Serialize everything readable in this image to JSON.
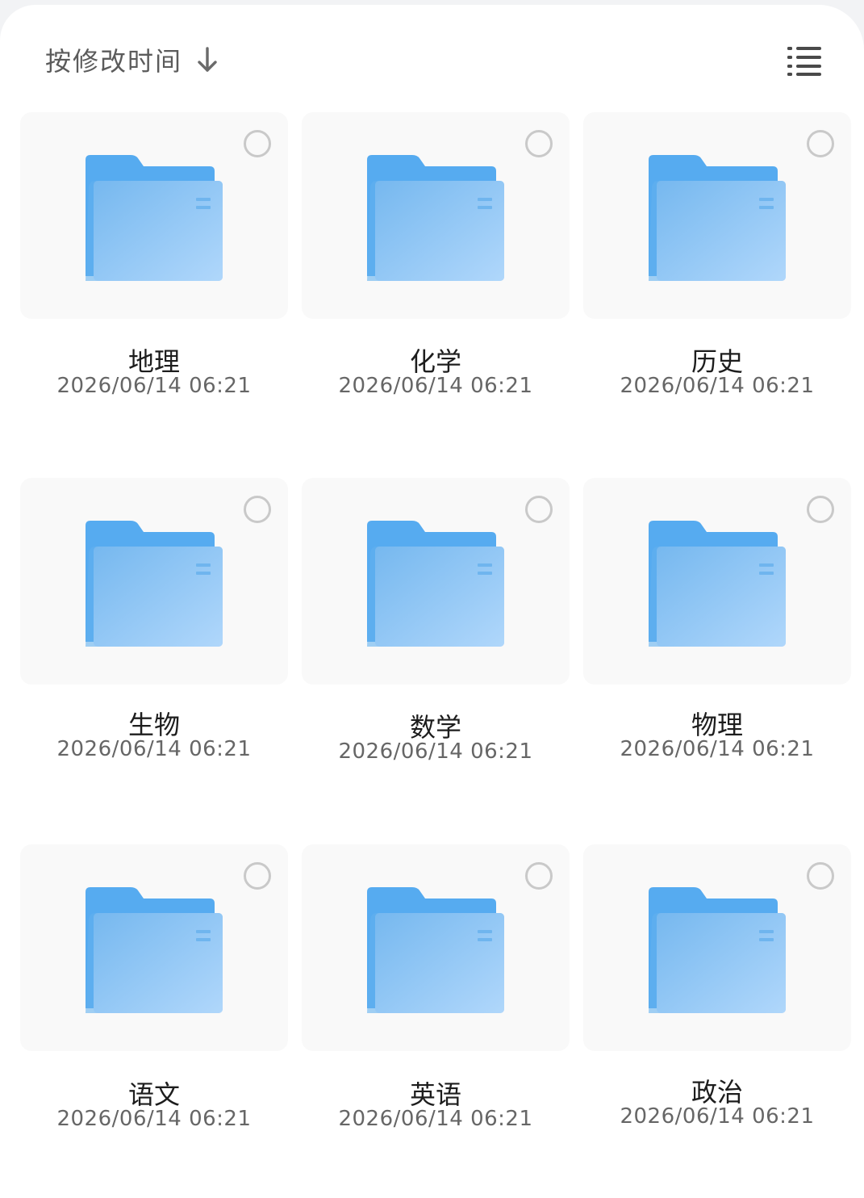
{
  "sort": {
    "label": "按修改时间",
    "direction_icon": "arrow-down-icon"
  },
  "view_toggle": {
    "icon": "list-view-icon"
  },
  "folders": [
    {
      "name": "地理",
      "date": "2026/06/14 06:21"
    },
    {
      "name": "化学",
      "date": "2026/06/14 06:21"
    },
    {
      "name": "历史",
      "date": "2026/06/14 06:21"
    },
    {
      "name": "生物",
      "date": "2026/06/14 06:21"
    },
    {
      "name": "数学",
      "date": "2026/06/14 06:21"
    },
    {
      "name": "物理",
      "date": "2026/06/14 06:21"
    },
    {
      "name": "语文",
      "date": "2026/06/14 06:21"
    },
    {
      "name": "英语",
      "date": "2026/06/14 06:21"
    },
    {
      "name": "政治",
      "date": "2026/06/14 06:21"
    }
  ],
  "colors": {
    "folder_back": "#5aaef0",
    "folder_front_start": "#7dbcf0",
    "folder_front_end": "#aed6fb",
    "check_border": "#c9c9c9"
  }
}
